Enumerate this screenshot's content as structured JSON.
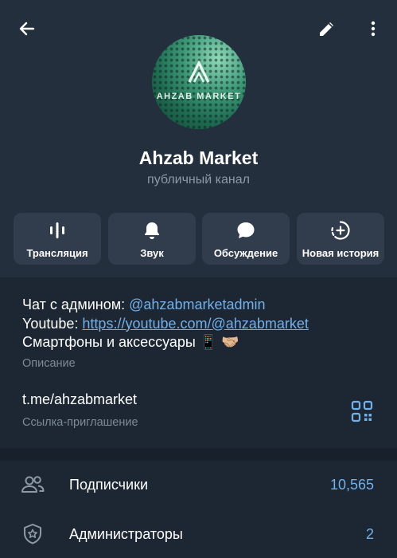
{
  "topbar": {
    "back_icon": "arrow-left-icon",
    "edit_icon": "pencil-icon",
    "more_icon": "more-vertical-icon"
  },
  "channel": {
    "avatar_text": "AHZAB MARKET",
    "name": "Ahzab Market",
    "subtitle": "публичный канал"
  },
  "actions": [
    {
      "label": "Трансляция",
      "icon": "live-stream-icon"
    },
    {
      "label": "Звук",
      "icon": "bell-icon"
    },
    {
      "label": "Обсуждение",
      "icon": "chat-bubble-icon"
    },
    {
      "label": "Новая история",
      "icon": "add-story-icon"
    }
  ],
  "info": {
    "desc_line1_prefix": "Чат с админом: ",
    "desc_line1_link": "@ahzabmarketadmin",
    "desc_line2_prefix": "Youtube: ",
    "desc_line2_link": "https://youtube.com/@ahzabmarket",
    "desc_line3": "Смартфоны и аксессуары 📱 🤝🏼",
    "desc_label": "Описание",
    "link": "t.me/ahzabmarket",
    "link_label": "Ссылка-приглашение",
    "qr_icon": "qr-code-icon"
  },
  "list": [
    {
      "label": "Подписчики",
      "value": "10,565",
      "icon": "people-icon"
    },
    {
      "label": "Администраторы",
      "value": "2",
      "icon": "shield-star-icon"
    }
  ],
  "colors": {
    "background": "#1d2733",
    "header": "#242f3d",
    "button": "#313d4c",
    "accent": "#71b0ea",
    "secondary_text": "#8d99a6"
  }
}
